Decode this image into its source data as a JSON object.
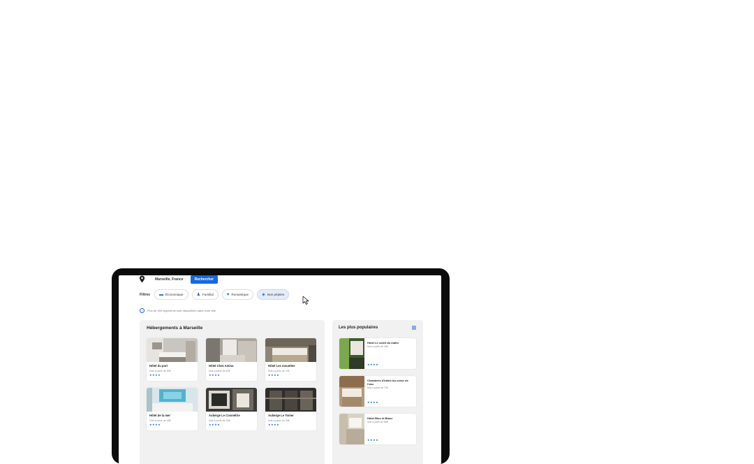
{
  "search": {
    "location": "Marseille, France",
    "button_label": "Rechercher"
  },
  "filters": {
    "label": "Filtres",
    "chips": [
      {
        "label": "Économique",
        "icon": "money-icon",
        "active": false
      },
      {
        "label": "Familial",
        "icon": "person-icon",
        "active": false
      },
      {
        "label": "Romantique",
        "icon": "heart-icon",
        "active": false
      },
      {
        "label": "Non pépites",
        "icon": "gem-icon",
        "active": true
      }
    ]
  },
  "info_text": "Plus de 400 logements sont disponibles dans votre ville",
  "main_section": {
    "title": "Hébergements à Marseille",
    "hotels": [
      {
        "name": "Hôtel du port",
        "price": "Nuit à partir de 54€",
        "stars": "★★★★"
      },
      {
        "name": "Hôtel Chez Amina",
        "price": "Nuit à partir de 62€",
        "stars": "★★★★"
      },
      {
        "name": "Hôtel Les mouettes",
        "price": "Nuit à partir de 74€",
        "stars": "★★★★"
      },
      {
        "name": "Hôtel de la mer",
        "price": "Nuit à partir de 48€",
        "stars": "★★★★"
      },
      {
        "name": "Auberge Le Cosmétrie",
        "price": "Nuit à partir de 33€",
        "stars": "★★★★"
      },
      {
        "name": "Auberge Le Tonier",
        "price": "Nuit à partir de 39€",
        "stars": "★★★★"
      }
    ]
  },
  "side_section": {
    "title": "Les plus populaires",
    "hotels": [
      {
        "name": "Hôtel Le soleil du matin",
        "price": "Nuit à partir de 45€",
        "stars": "★★★★"
      },
      {
        "name": "Chambres d'hôtes Au coeur de l'eau",
        "price": "Nuit à partir de 72€",
        "stars": "★★★★"
      },
      {
        "name": "Hôtel Bleu et Blanc",
        "price": "Nuit à partir de 68€",
        "stars": "★★★★"
      }
    ]
  },
  "colors": {
    "accent": "#1668e3",
    "panel": "#f1f1f1",
    "device_frame": "#0b0b0b"
  }
}
